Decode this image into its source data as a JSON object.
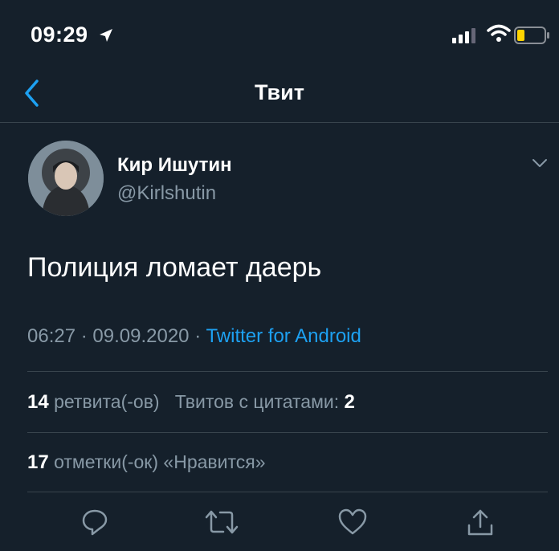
{
  "status_bar": {
    "time": "09:29"
  },
  "nav": {
    "title": "Твит"
  },
  "author": {
    "name": "Кир Ишутин",
    "handle": "@Kirlshutin"
  },
  "tweet": {
    "text": "Полиция ломает даерь",
    "time": "06:27",
    "date": "09.09.2020",
    "source": "Twitter for Android",
    "sep": "·"
  },
  "stats": {
    "retweets_count": "14",
    "retweets_label": "ретвита(-ов)",
    "quotes_label": "Твитов с цитатами:",
    "quotes_count": "2",
    "likes_count": "17",
    "likes_label": "отметки(-ок) «Нравится»"
  },
  "colors": {
    "background": "#15202b",
    "accent": "#1da1f2",
    "muted": "#8899a6",
    "battery": "#ffd400"
  }
}
